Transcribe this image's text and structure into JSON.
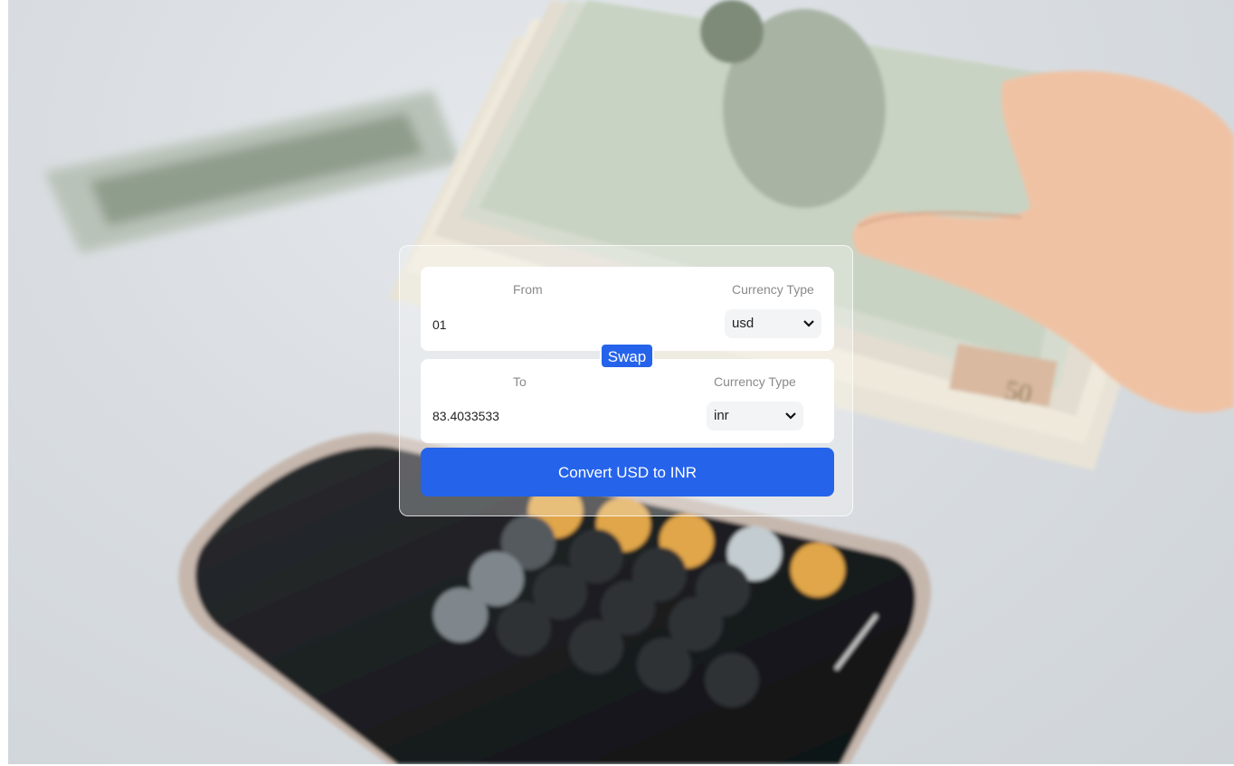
{
  "background": {
    "image_description_icon": "money-and-calculator-photo"
  },
  "from_card": {
    "label": "From",
    "currency_type_label": "Currency Type",
    "amount": "01",
    "currency": "usd"
  },
  "swap": {
    "label": "Swap"
  },
  "to_card": {
    "label": "To",
    "currency_type_label": "Currency Type",
    "amount": "83.4033533",
    "currency": "inr"
  },
  "convert": {
    "label": "Convert USD to INR"
  },
  "colors": {
    "accent": "#2563eb",
    "card": "#ffffff",
    "select_bg": "#f3f4f6"
  }
}
